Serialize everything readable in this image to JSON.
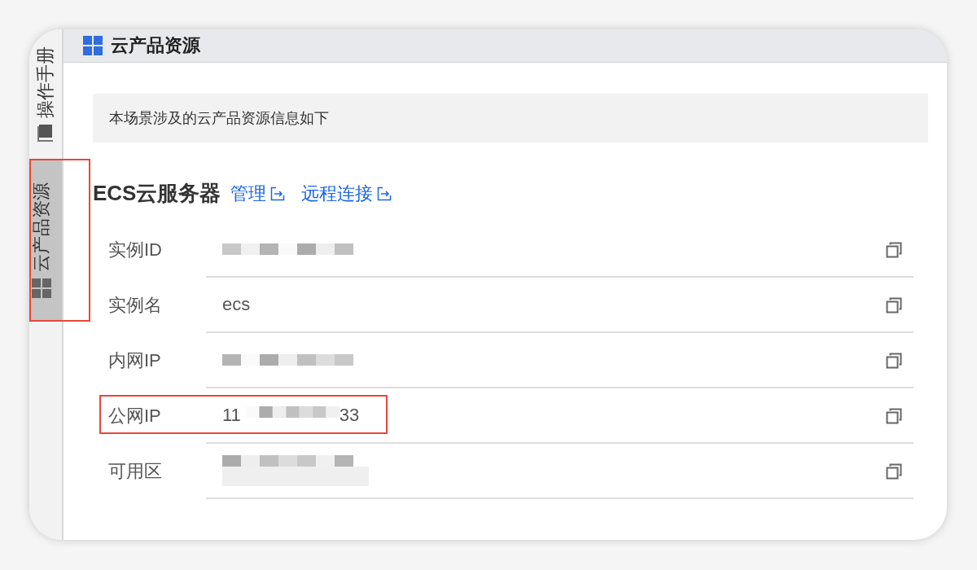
{
  "sidebar": {
    "tabs": [
      {
        "label": "操作手册",
        "selected": false,
        "highlighted": false
      },
      {
        "label": "云产品资源",
        "selected": true,
        "highlighted": true
      }
    ]
  },
  "header": {
    "title": "云产品资源"
  },
  "notice": "本场景涉及的云产品资源信息如下",
  "section": {
    "title": "ECS云服务器",
    "links": [
      {
        "label": "管理"
      },
      {
        "label": "远程连接"
      }
    ]
  },
  "rows": [
    {
      "label": "实例ID",
      "kind": "redacted",
      "highlighted": false
    },
    {
      "label": "实例名",
      "kind": "text",
      "value": "ecs",
      "highlighted": false
    },
    {
      "label": "内网IP",
      "kind": "redacted",
      "highlighted": false
    },
    {
      "label": "公网IP",
      "kind": "partial",
      "prefix": "11",
      "suffix": "33",
      "highlighted": true
    },
    {
      "label": "可用区",
      "kind": "redacted",
      "highlighted": false
    }
  ]
}
